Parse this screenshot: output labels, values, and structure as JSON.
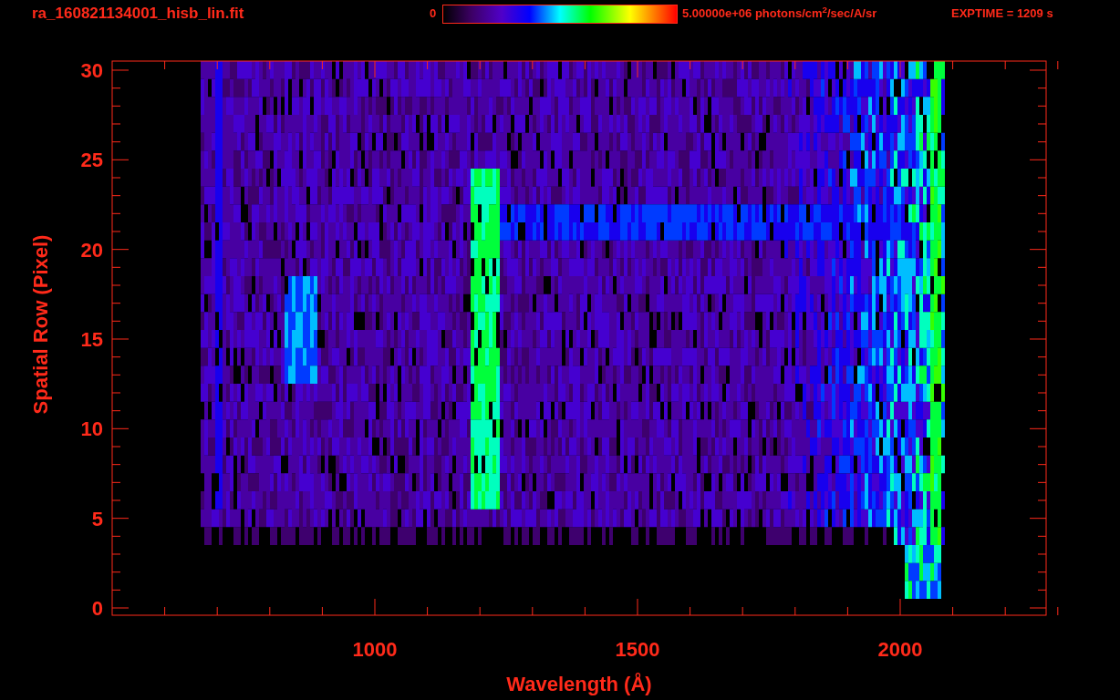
{
  "header": {
    "file_name": "ra_160821134001_hisb_lin.fit",
    "colorbar_min": "0",
    "colorbar_max": "5.00000e+06 photons/cm$^{2}$/sec/A/sr",
    "exposure": "EXPTIME = 1209 s"
  },
  "plot": {
    "ylabel": "Spatial Row (Pixel)",
    "xlabel": "Wavelength (Å)",
    "yticks": [
      "30",
      "25",
      "20",
      "15",
      "10",
      "5",
      "0"
    ],
    "xticks": [
      "1000",
      "1500",
      "2000"
    ]
  }
}
